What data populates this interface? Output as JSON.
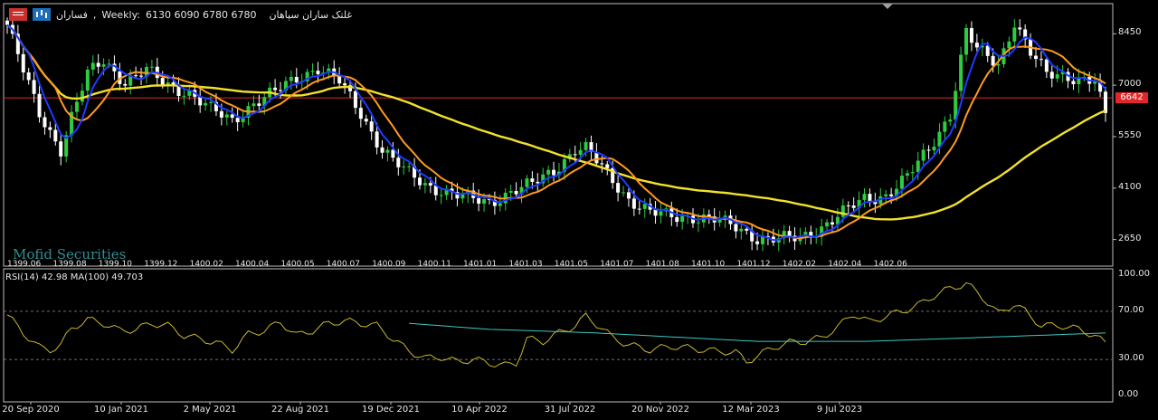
{
  "header": {
    "symbol": "فساران",
    "timeframe": "Weekly:",
    "ohlc": "6130 6090 6780 6780",
    "company": "غلتک ساران سپاهان"
  },
  "watermark": "Mofid Securities",
  "price_tag": "6642",
  "rsi_label": "RSI(14) 42.98 MA(100) 49.703",
  "top_date_labels": [
    "1399.06",
    "1399.08",
    "1399.10",
    "1399.12",
    "1400.02",
    "1400.04",
    "1400.05",
    "1400.07",
    "1400.09",
    "1400.11",
    "1401.01",
    "1401.03",
    "1401.05",
    "1401.07",
    "1401.08",
    "1401.10",
    "1401.12",
    "1402.02",
    "1402.04",
    "1402.06"
  ],
  "colors": {
    "background": "#000000",
    "bull": "#2ecc40",
    "bear": "#ffffff",
    "ma_fast": "#1e3cff",
    "ma_mid": "#ff9a1f",
    "ma_slow": "#f2e12b",
    "price_line": "#e0272a",
    "rsi": "#c8b830",
    "rsi_ma": "#3cc8c0",
    "grid": "#707070"
  },
  "chart_data": [
    {
      "type": "candlestick",
      "title": "",
      "y_ticks": [
        2650,
        4100,
        5550,
        7000,
        8450
      ],
      "ylim": [
        1900,
        9300
      ],
      "current_price": 6642,
      "x_ticks": [
        "20 Sep 2020",
        "10 Jan 2021",
        "2 May 2021",
        "22 Aug 2021",
        "19 Dec 2021",
        "10 Apr 2022",
        "31 Jul 2022",
        "20 Nov 2022",
        "12 Mar 2023",
        "9 Jul 2023"
      ],
      "price_anchors": [
        [
          0,
          8700
        ],
        [
          3,
          7400
        ],
        [
          6,
          6200
        ],
        [
          8,
          5700
        ],
        [
          10,
          5200
        ],
        [
          12,
          6100
        ],
        [
          15,
          7300
        ],
        [
          18,
          7700
        ],
        [
          22,
          7100
        ],
        [
          26,
          7400
        ],
        [
          30,
          7000
        ],
        [
          34,
          6800
        ],
        [
          38,
          6300
        ],
        [
          42,
          6000
        ],
        [
          46,
          6500
        ],
        [
          50,
          6800
        ],
        [
          54,
          7200
        ],
        [
          58,
          7500
        ],
        [
          62,
          7100
        ],
        [
          66,
          6200
        ],
        [
          70,
          5200
        ],
        [
          74,
          4600
        ],
        [
          78,
          4200
        ],
        [
          82,
          4000
        ],
        [
          86,
          3800
        ],
        [
          90,
          3700
        ],
        [
          94,
          4000
        ],
        [
          98,
          4200
        ],
        [
          102,
          4600
        ],
        [
          106,
          5200
        ],
        [
          108,
          5200
        ],
        [
          112,
          4500
        ],
        [
          116,
          3800
        ],
        [
          120,
          3400
        ],
        [
          124,
          3300
        ],
        [
          128,
          3300
        ],
        [
          132,
          3200
        ],
        [
          136,
          3000
        ],
        [
          140,
          2700
        ],
        [
          144,
          2650
        ],
        [
          148,
          2700
        ],
        [
          152,
          3000
        ],
        [
          156,
          3400
        ],
        [
          160,
          3800
        ],
        [
          164,
          3900
        ],
        [
          168,
          4400
        ],
        [
          172,
          5200
        ],
        [
          176,
          6200
        ],
        [
          179,
          8500
        ],
        [
          181,
          8000
        ],
        [
          185,
          7600
        ],
        [
          188,
          8800
        ],
        [
          191,
          7900
        ],
        [
          194,
          7300
        ],
        [
          197,
          7300
        ],
        [
          200,
          7200
        ],
        [
          203,
          7100
        ],
        [
          205,
          6100
        ]
      ],
      "rsi_ticks": [
        0,
        30,
        70,
        100
      ],
      "rsi_anchors": [
        [
          0,
          67
        ],
        [
          3,
          52
        ],
        [
          6,
          40
        ],
        [
          8,
          38
        ],
        [
          10,
          42
        ],
        [
          12,
          56
        ],
        [
          15,
          63
        ],
        [
          18,
          60
        ],
        [
          21,
          54
        ],
        [
          24,
          55
        ],
        [
          27,
          60
        ],
        [
          30,
          58
        ],
        [
          33,
          50
        ],
        [
          36,
          47
        ],
        [
          39,
          44
        ],
        [
          42,
          38
        ],
        [
          45,
          51
        ],
        [
          48,
          54
        ],
        [
          51,
          61
        ],
        [
          54,
          50
        ],
        [
          57,
          54
        ],
        [
          60,
          60
        ],
        [
          63,
          62
        ],
        [
          66,
          60
        ],
        [
          69,
          58
        ],
        [
          72,
          47
        ],
        [
          75,
          37
        ],
        [
          78,
          31
        ],
        [
          81,
          32
        ],
        [
          84,
          28
        ],
        [
          87,
          30
        ],
        [
          90,
          27
        ],
        [
          93,
          25
        ],
        [
          95,
          27
        ],
        [
          97,
          47
        ],
        [
          100,
          45
        ],
        [
          103,
          52
        ],
        [
          106,
          58
        ],
        [
          108,
          66
        ],
        [
          111,
          56
        ],
        [
          113,
          48
        ],
        [
          116,
          42
        ],
        [
          120,
          38
        ],
        [
          124,
          41
        ],
        [
          128,
          39
        ],
        [
          132,
          37
        ],
        [
          136,
          36
        ],
        [
          138,
          28
        ],
        [
          140,
          33
        ],
        [
          143,
          40
        ],
        [
          146,
          44
        ],
        [
          149,
          45
        ],
        [
          152,
          48
        ],
        [
          155,
          57
        ],
        [
          158,
          68
        ],
        [
          161,
          61
        ],
        [
          164,
          66
        ],
        [
          167,
          70
        ],
        [
          170,
          75
        ],
        [
          173,
          83
        ],
        [
          176,
          89
        ],
        [
          179,
          93
        ],
        [
          182,
          82
        ],
        [
          185,
          68
        ],
        [
          188,
          76
        ],
        [
          190,
          70
        ],
        [
          193,
          58
        ],
        [
          197,
          58
        ],
        [
          200,
          55
        ],
        [
          203,
          50
        ],
        [
          205,
          43
        ]
      ],
      "rsi_ma_anchors": [
        [
          75,
          60
        ],
        [
          90,
          55
        ],
        [
          110,
          52
        ],
        [
          140,
          45
        ],
        [
          160,
          45
        ],
        [
          180,
          48
        ],
        [
          205,
          52
        ]
      ]
    }
  ]
}
